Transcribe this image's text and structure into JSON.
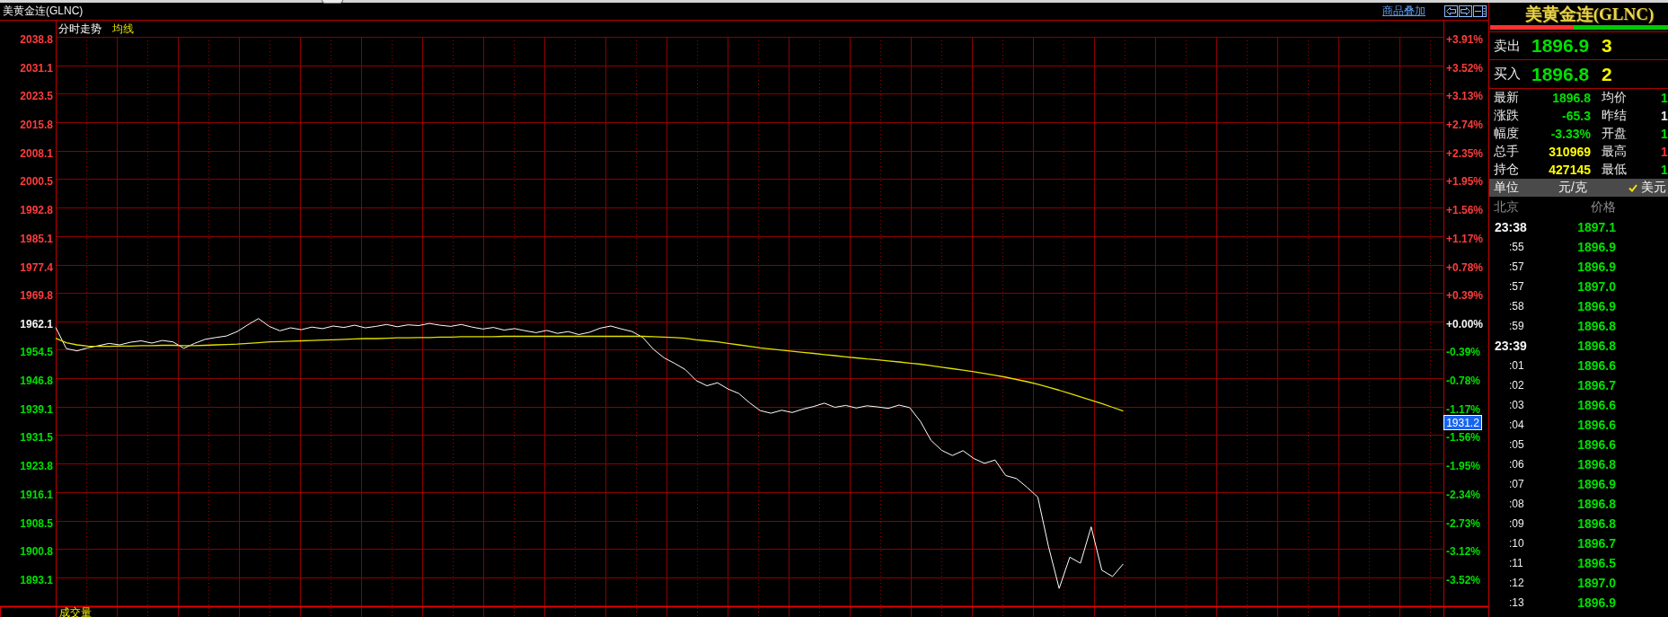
{
  "window": {
    "title": "美黄金连(GLNC)"
  },
  "toolbar": {
    "link": "商品叠加"
  },
  "chart": {
    "chart_data": {
      "type": "line",
      "grid": true,
      "ylim": [
        1885.4,
        2038.8
      ],
      "yticks": [
        2038.8,
        2031.1,
        2023.5,
        2015.8,
        2008.1,
        2000.5,
        1992.8,
        1985.1,
        1977.4,
        1969.8,
        1962.1,
        1954.5,
        1946.8,
        1939.1,
        1931.5,
        1923.8,
        1916.1,
        1908.5,
        1900.8,
        1893.1
      ],
      "series": [
        {
          "name": "分时走势",
          "color": "#ffffff",
          "values": [
            1960.5,
            1954.8,
            1954.2,
            1955.0,
            1955.6,
            1956.2,
            1955.8,
            1956.5,
            1956.9,
            1956.3,
            1957.0,
            1956.6,
            1954.9,
            1956.2,
            1957.3,
            1957.8,
            1958.2,
            1959.4,
            1961.2,
            1962.9,
            1960.8,
            1959.6,
            1960.4,
            1959.9,
            1960.6,
            1960.2,
            1960.9,
            1960.5,
            1961.1,
            1960.4,
            1960.8,
            1961.3,
            1960.7,
            1961.2,
            1961.0,
            1961.6,
            1961.1,
            1960.8,
            1961.3,
            1960.6,
            1960.1,
            1960.5,
            1959.8,
            1960.2,
            1959.6,
            1959.1,
            1959.7,
            1958.9,
            1959.4,
            1958.6,
            1959.2,
            1960.3,
            1960.9,
            1960.1,
            1959.4,
            1957.8,
            1954.6,
            1952.3,
            1950.8,
            1949.1,
            1946.2,
            1944.8,
            1945.6,
            1943.9,
            1942.7,
            1940.2,
            1938.1,
            1937.4,
            1938.2,
            1937.6,
            1938.5,
            1939.2,
            1940.1,
            1939.0,
            1939.5,
            1938.8,
            1939.4,
            1939.1,
            1938.7,
            1939.6,
            1938.9,
            1935.2,
            1930.1,
            1927.4,
            1926.0,
            1927.3,
            1925.2,
            1923.9,
            1924.8,
            1920.6,
            1919.8,
            1917.4,
            1914.8,
            1901.5,
            1890.2,
            1898.6,
            1897.0,
            1906.8,
            1895.1,
            1893.4,
            1896.8,
            null,
            null,
            null,
            null,
            null,
            null,
            null,
            null,
            null,
            null,
            null,
            null,
            null,
            null,
            null,
            null,
            null,
            null,
            null,
            null,
            null,
            null,
            null,
            null,
            null,
            null,
            null,
            null,
            null,
            null
          ]
        },
        {
          "name": "均线",
          "color": "#e0e000",
          "values": [
            1957.6,
            1956.4,
            1955.8,
            1955.5,
            1955.4,
            1955.4,
            1955.5,
            1955.5,
            1955.6,
            1955.6,
            1955.7,
            1955.7,
            1955.6,
            1955.6,
            1955.7,
            1955.8,
            1955.9,
            1956.0,
            1956.2,
            1956.4,
            1956.6,
            1956.7,
            1956.8,
            1956.9,
            1957.0,
            1957.1,
            1957.2,
            1957.3,
            1957.4,
            1957.5,
            1957.5,
            1957.6,
            1957.7,
            1957.7,
            1957.8,
            1957.8,
            1957.9,
            1957.9,
            1958.0,
            1958.0,
            1958.0,
            1958.0,
            1958.1,
            1958.1,
            1958.1,
            1958.1,
            1958.1,
            1958.1,
            1958.1,
            1958.1,
            1958.1,
            1958.1,
            1958.1,
            1958.1,
            1958.1,
            1958.1,
            1958.0,
            1957.9,
            1957.8,
            1957.6,
            1957.2,
            1956.9,
            1956.6,
            1956.2,
            1955.8,
            1955.4,
            1955.0,
            1954.7,
            1954.4,
            1954.1,
            1953.8,
            1953.5,
            1953.2,
            1952.9,
            1952.6,
            1952.3,
            1952.0,
            1951.8,
            1951.5,
            1951.2,
            1950.9,
            1950.6,
            1950.2,
            1949.8,
            1949.4,
            1949.0,
            1948.6,
            1948.1,
            1947.6,
            1947.1,
            1946.5,
            1945.9,
            1945.2,
            1944.4,
            1943.6,
            1942.7,
            1941.8,
            1940.9,
            1940.0,
            1939.0,
            1938.0,
            null,
            null,
            null,
            null,
            null,
            null,
            null,
            null,
            null,
            null,
            null,
            null,
            null,
            null,
            null,
            null,
            null,
            null,
            null,
            null,
            null,
            null,
            null,
            null,
            null,
            null,
            null,
            null,
            null,
            null
          ]
        }
      ]
    },
    "percent_ticks": [
      {
        "label": "+3.91%",
        "color": "#ff3c3c"
      },
      {
        "label": "+3.52%",
        "color": "#ff3c3c"
      },
      {
        "label": "+3.13%",
        "color": "#ff3c3c"
      },
      {
        "label": "+2.74%",
        "color": "#ff3c3c"
      },
      {
        "label": "+2.35%",
        "color": "#ff3c3c"
      },
      {
        "label": "+1.95%",
        "color": "#ff3c3c"
      },
      {
        "label": "+1.56%",
        "color": "#ff3c3c"
      },
      {
        "label": "+1.17%",
        "color": "#ff3c3c"
      },
      {
        "label": "+0.78%",
        "color": "#ff3c3c"
      },
      {
        "label": "+0.39%",
        "color": "#ff3c3c"
      },
      {
        "label": "+0.00%",
        "color": "#f4f4f4"
      },
      {
        "label": "-0.39%",
        "color": "#00e000"
      },
      {
        "label": "-0.78%",
        "color": "#00e000"
      },
      {
        "label": "-1.17%",
        "color": "#00e000"
      },
      {
        "label": "-1.56%",
        "color": "#00e000"
      },
      {
        "label": "-1.95%",
        "color": "#00e000"
      },
      {
        "label": "-2.34%",
        "color": "#00e000"
      },
      {
        "label": "-2.73%",
        "color": "#00e000"
      },
      {
        "label": "-3.12%",
        "color": "#00e000"
      },
      {
        "label": "-3.52%",
        "color": "#00e000"
      }
    ],
    "cursor_label": "1931.2",
    "volume_panel": {
      "title": "成交量"
    }
  },
  "quote": {
    "title": "美黄金连(GLNC)",
    "ratio_bar": {
      "level": 0.47
    },
    "book": [
      {
        "label": "卖出",
        "price": "1896.9",
        "size": "3"
      },
      {
        "label": "买入",
        "price": "1896.8",
        "size": "2"
      }
    ],
    "stats": [
      {
        "label": "最新",
        "value": "1896.8",
        "color": "#00e000"
      },
      {
        "label": "均价",
        "value": "1",
        "color": "#00e000"
      },
      {
        "label": "涨跌",
        "value": "-65.3",
        "color": "#00e000"
      },
      {
        "label": "昨结",
        "value": "1",
        "color": "#e8e8e8"
      },
      {
        "label": "幅度",
        "value": "-3.33%",
        "color": "#00e000"
      },
      {
        "label": "开盘",
        "value": "1",
        "color": "#00e000"
      },
      {
        "label": "总手",
        "value": "310969",
        "color": "#ffff00"
      },
      {
        "label": "最高",
        "value": "1",
        "color": "#ff3232"
      },
      {
        "label": "持仓",
        "value": "427145",
        "color": "#ffff00"
      },
      {
        "label": "最低",
        "value": "1",
        "color": "#00e000"
      }
    ],
    "unit": {
      "label": "单位",
      "options": [
        {
          "label": "元/克",
          "selected": false
        },
        {
          "label": "美元",
          "selected": true
        }
      ]
    },
    "ticks_header": {
      "time": "北京",
      "price": "价格"
    },
    "ticks": [
      {
        "time": "23:38",
        "kind": "minute",
        "price": "1897.1"
      },
      {
        "time": ":55",
        "kind": "second",
        "price": "1896.9"
      },
      {
        "time": ":57",
        "kind": "second",
        "price": "1896.9"
      },
      {
        "time": ":57",
        "kind": "second",
        "price": "1897.0"
      },
      {
        "time": ":58",
        "kind": "second",
        "price": "1896.9"
      },
      {
        "time": ":59",
        "kind": "second",
        "price": "1896.8"
      },
      {
        "time": "23:39",
        "kind": "minute",
        "price": "1896.8"
      },
      {
        "time": ":01",
        "kind": "second",
        "price": "1896.6"
      },
      {
        "time": ":02",
        "kind": "second",
        "price": "1896.7"
      },
      {
        "time": ":03",
        "kind": "second",
        "price": "1896.6"
      },
      {
        "time": ":04",
        "kind": "second",
        "price": "1896.6"
      },
      {
        "time": ":05",
        "kind": "second",
        "price": "1896.6"
      },
      {
        "time": ":06",
        "kind": "second",
        "price": "1896.8"
      },
      {
        "time": ":07",
        "kind": "second",
        "price": "1896.9"
      },
      {
        "time": ":08",
        "kind": "second",
        "price": "1896.8"
      },
      {
        "time": ":09",
        "kind": "second",
        "price": "1896.8"
      },
      {
        "time": ":10",
        "kind": "second",
        "price": "1896.7"
      },
      {
        "time": ":11",
        "kind": "second",
        "price": "1896.5"
      },
      {
        "time": ":12",
        "kind": "second",
        "price": "1897.0"
      },
      {
        "time": ":13",
        "kind": "second",
        "price": "1896.9"
      }
    ]
  }
}
